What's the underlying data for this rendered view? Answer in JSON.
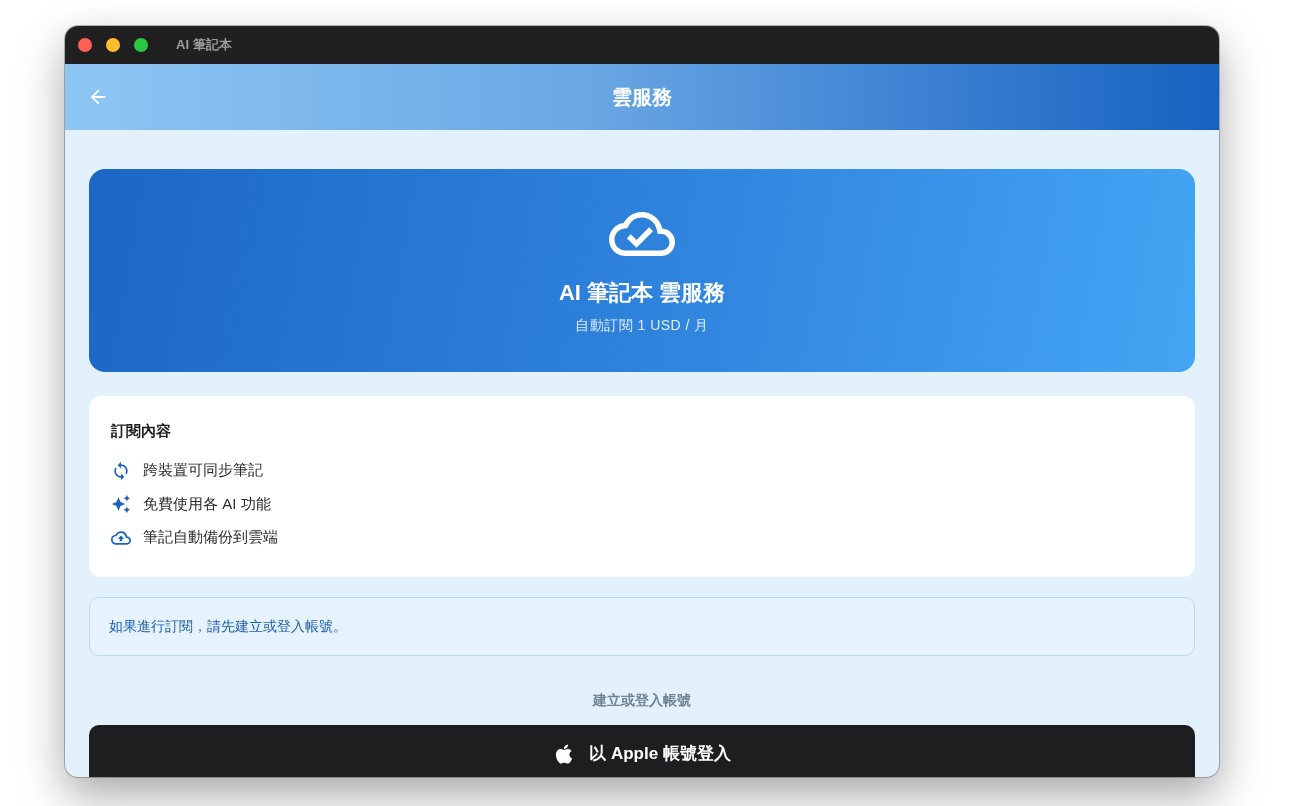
{
  "window": {
    "title": "AI 筆記本"
  },
  "app_bar": {
    "title": "雲服務"
  },
  "hero": {
    "title": "AI 筆記本 雲服務",
    "subtitle": "自動訂閱 1 USD / 月"
  },
  "features": {
    "title": "訂閱內容",
    "items": [
      {
        "kind": "sync",
        "label": "跨裝置可同步筆記"
      },
      {
        "kind": "ai",
        "label": "免費使用各 AI 功能"
      },
      {
        "kind": "backup",
        "label": "筆記自動備份到雲端"
      }
    ]
  },
  "notice": {
    "text": "如果進行訂閱，請先建立或登入帳號。"
  },
  "account": {
    "label": "建立或登入帳號",
    "button": "以 Apple 帳號登入"
  }
}
